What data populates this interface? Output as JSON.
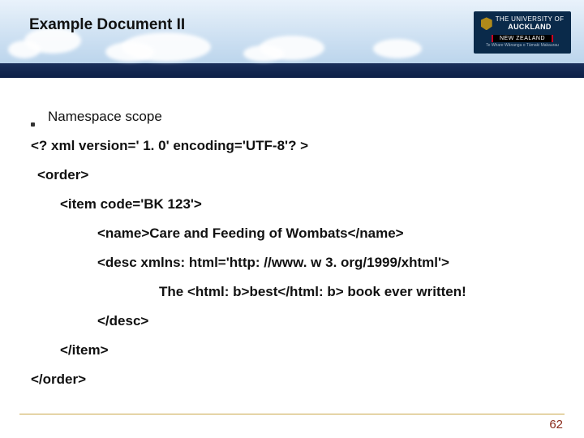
{
  "header": {
    "title": "Example Document II",
    "logo": {
      "line1": "THE UNIVERSITY OF",
      "line2": "AUCKLAND",
      "nz": "NEW ZEALAND",
      "maori": "Te Whare Wānanga o Tāmaki Makaurau"
    }
  },
  "body": {
    "bullet": "Namespace scope",
    "lines": [
      "<? xml version=' 1. 0' encoding='UTF-8'? >",
      "<order>",
      "<item code='BK 123'>",
      "<name>Care and Feeding of Wombats</name>",
      "<desc xmlns: html='http: //www. w 3. org/1999/xhtml'>",
      "The <html: b>best</html: b> book ever written!",
      "</desc>",
      "</item>",
      "</order>"
    ]
  },
  "footer": {
    "page": "62"
  }
}
